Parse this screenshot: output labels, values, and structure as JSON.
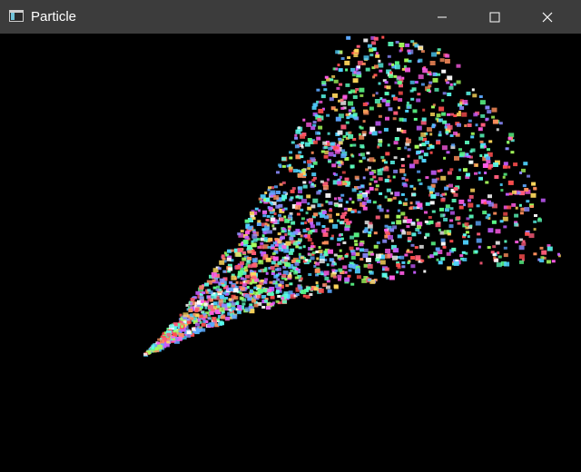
{
  "window": {
    "title": "Particle",
    "icon": "app-window-icon",
    "controls": {
      "minimize_icon": "minimize-icon",
      "maximize_icon": "maximize-icon",
      "close_icon": "close-icon"
    }
  },
  "colors": {
    "titlebar": "#3c3c3c",
    "title_text": "#ffffff",
    "canvas_background": "#000000"
  },
  "scene": {
    "particle_colors": [
      "#ff5c7a",
      "#5cff8a",
      "#5ca8ff",
      "#ffd95c",
      "#c65cff",
      "#5cfff0",
      "#ff8f5c",
      "#a6ff5c",
      "#ff5ce6",
      "#ffffff",
      "#8c8cff",
      "#5cffc0",
      "#ff4f4f",
      "#4fd2ff"
    ]
  }
}
